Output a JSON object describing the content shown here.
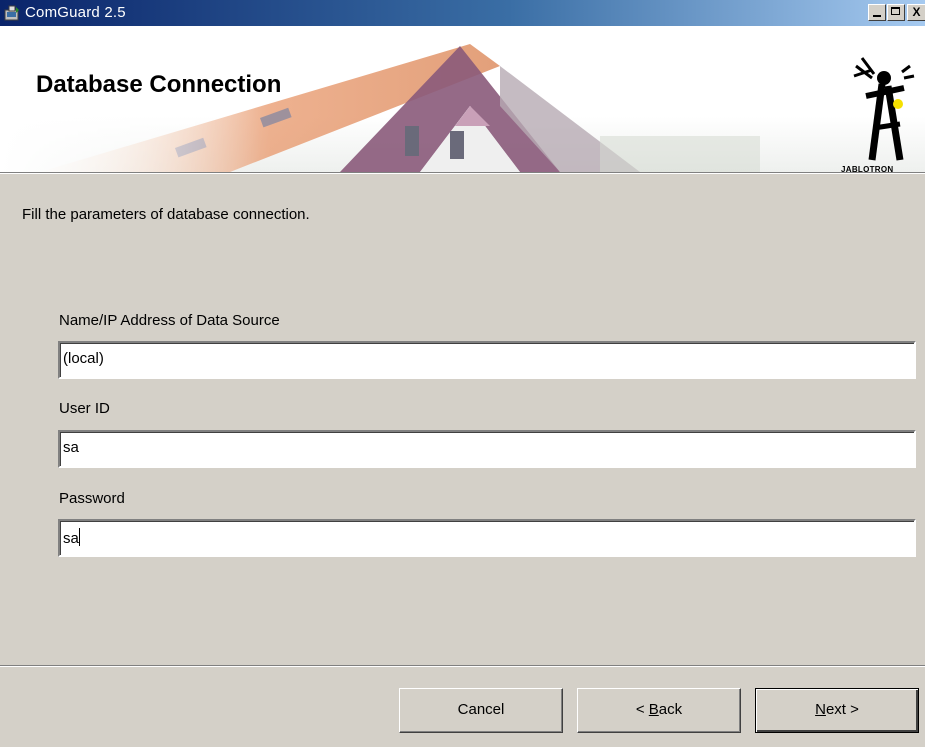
{
  "window": {
    "title": "ComGuard 2.5",
    "icon": "installer-icon",
    "controls": [
      "minimize",
      "maximize",
      "close"
    ],
    "close_glyph": "X"
  },
  "banner": {
    "title": "Database Connection",
    "logo_text": "JABLOTRON",
    "logo_icon": "jablotron-logo-icon"
  },
  "instruction": "Fill the parameters of database connection.",
  "fields": {
    "datasource": {
      "label": "Name/IP Address of Data Source",
      "value": "(local)"
    },
    "userid": {
      "label": "User ID",
      "value": "sa"
    },
    "password": {
      "label": "Password",
      "value": "sa"
    }
  },
  "buttons": {
    "cancel": "Cancel",
    "back": {
      "arrow": "<",
      "mnemonic": "B",
      "rest": "ack"
    },
    "next": {
      "mnemonic": "N",
      "rest": "ext",
      "arrow": ">"
    }
  },
  "colors": {
    "titlebar_start": "#0a246a",
    "titlebar_end": "#a6caf0",
    "dialog_bg": "#d4d0c8"
  }
}
